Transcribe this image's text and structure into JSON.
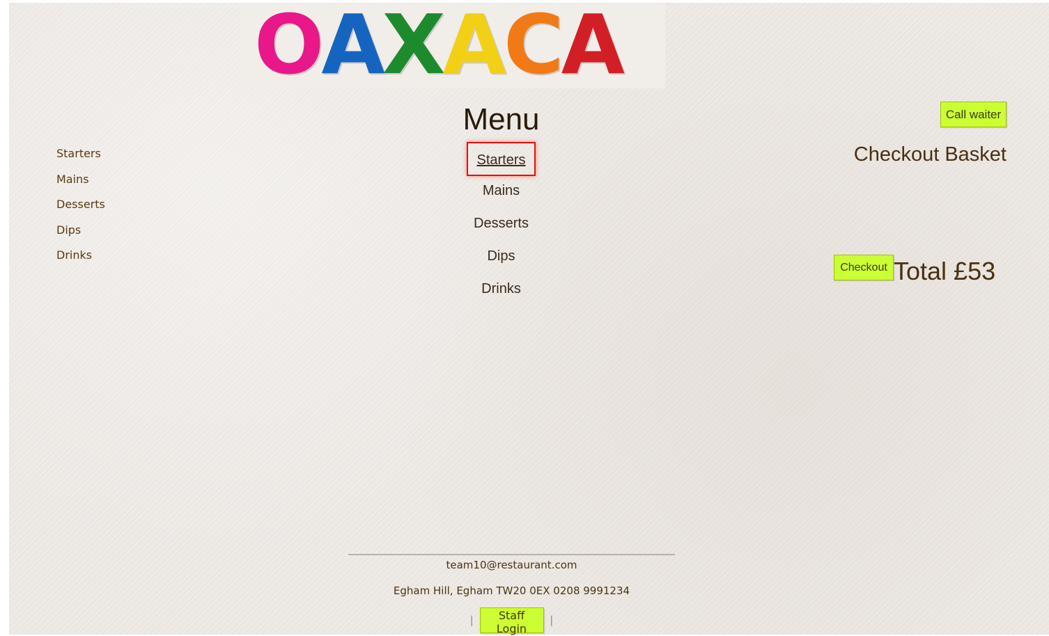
{
  "logo": {
    "text": "OAXACA",
    "letters": [
      {
        "char": "O",
        "color": "#e8178a"
      },
      {
        "char": "A",
        "color": "#1565c0"
      },
      {
        "char": "X",
        "color": "#1e8a2e"
      },
      {
        "char": "A",
        "color": "#f2d016"
      },
      {
        "char": "C",
        "color": "#f27a16"
      },
      {
        "char": "A",
        "color": "#d21f26"
      }
    ]
  },
  "side_nav": {
    "items": [
      "Starters",
      "Mains",
      "Desserts",
      "Dips",
      "Drinks"
    ]
  },
  "menu": {
    "title": "Menu",
    "items": [
      "Starters",
      "Mains",
      "Desserts",
      "Dips",
      "Drinks"
    ],
    "active_index": 0
  },
  "basket": {
    "call_waiter_label": "Call waiter",
    "title": "Checkout Basket",
    "checkout_label": "Checkout",
    "total_label": "Total",
    "total_value": "£53"
  },
  "footer": {
    "email": "team10@restaurant.com",
    "address": "Egham Hill, Egham TW20 0EX 0208 9991234",
    "staff_login_label": "Staff Login",
    "separator": "|"
  },
  "colors": {
    "button_bg": "#ccff33",
    "highlight_border": "#e01010",
    "text_brown": "#4a2f10"
  }
}
